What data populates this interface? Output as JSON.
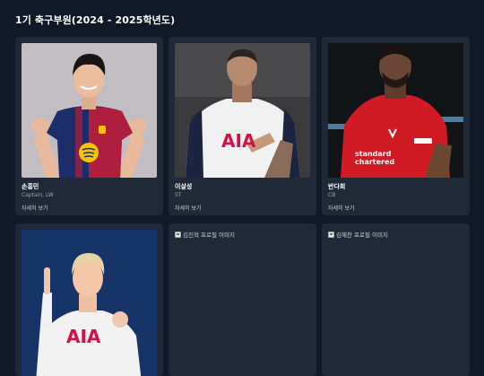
{
  "page_title": "1기 축구부원(2024 - 2025학년도)",
  "players": [
    {
      "name": "손흥민",
      "position": "Captain, LW",
      "more": "자세히 보기",
      "photo_icon": "player-photo-barcelona-kit"
    },
    {
      "name": "이살성",
      "position": "ST",
      "more": "자세히 보기",
      "photo_icon": "player-photo-tottenham-kit"
    },
    {
      "name": "반다희",
      "position": "CB",
      "more": "자세히 보기",
      "photo_icon": "player-photo-liverpool-kit"
    },
    {
      "photo_icon": "player-photo-tottenham-home-kit"
    },
    {
      "alt": "김진혁 프로필 이미지"
    },
    {
      "alt": "김해찬 프로필 이미지"
    }
  ],
  "colors": {
    "background": "#111827",
    "card": "#1f2937",
    "muted_text": "#9ca3af"
  }
}
